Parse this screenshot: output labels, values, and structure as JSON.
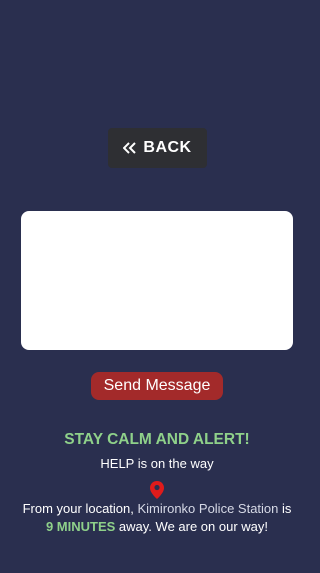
{
  "back": {
    "label": "BACK",
    "icon": "double-chevron-left-icon"
  },
  "message": {
    "value": "",
    "placeholder": ""
  },
  "send": {
    "label": "Send Message",
    "color": "#a32a2a"
  },
  "status": {
    "headline": "STAY CALM AND ALERT!",
    "subline": "HELP is on the way",
    "pin_icon": "location-pin-icon",
    "info_prefix": "From your location, ",
    "station": "Kimironko Police Station",
    "info_mid": " is",
    "eta": "9 MINUTES",
    "info_suffix": " away. We are on our way!"
  },
  "colors": {
    "background": "#2a2f4f",
    "accent_green": "#8fd18a",
    "pin_red": "#e01b1b"
  }
}
